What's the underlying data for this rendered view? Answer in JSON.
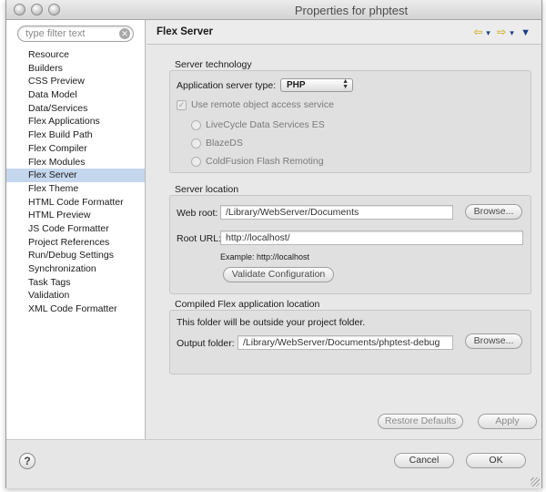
{
  "window": {
    "title": "Properties for phptest"
  },
  "filter": {
    "placeholder": "type filter text"
  },
  "nav": {
    "items": [
      "Resource",
      "Builders",
      "CSS Preview",
      "Data Model",
      "Data/Services",
      "Flex Applications",
      "Flex Build Path",
      "Flex Compiler",
      "Flex Modules",
      "Flex Server",
      "Flex Theme",
      "HTML Code Formatter",
      "HTML Preview",
      "JS Code Formatter",
      "Project References",
      "Run/Debug Settings",
      "Synchronization",
      "Task Tags",
      "Validation",
      "XML Code Formatter"
    ],
    "selected": "Flex Server"
  },
  "page": {
    "title": "Flex Server"
  },
  "server_technology": {
    "label": "Server technology",
    "app_server_type_label": "Application server type:",
    "app_server_type_value": "PHP",
    "remote_object_label": "Use remote object access service",
    "remote_object_checked": true,
    "options": [
      "LiveCycle Data Services ES",
      "BlazeDS",
      "ColdFusion Flash Remoting"
    ]
  },
  "server_location": {
    "label": "Server location",
    "web_root_label": "Web root:",
    "web_root_value": "/Library/WebServer/Documents",
    "browse_label": "Browse...",
    "root_url_label": "Root URL:",
    "root_url_value": "http://localhost/",
    "example_text": "Example: http://localhost",
    "validate_label": "Validate Configuration"
  },
  "compiled_location": {
    "label": "Compiled Flex application location",
    "note": "This folder will be outside your project folder.",
    "output_folder_label": "Output folder:",
    "output_folder_value": "/Library/WebServer/Documents/phptest-debug",
    "browse_label": "Browse..."
  },
  "actions": {
    "restore_defaults": "Restore Defaults",
    "apply": "Apply",
    "cancel": "Cancel",
    "ok": "OK"
  }
}
